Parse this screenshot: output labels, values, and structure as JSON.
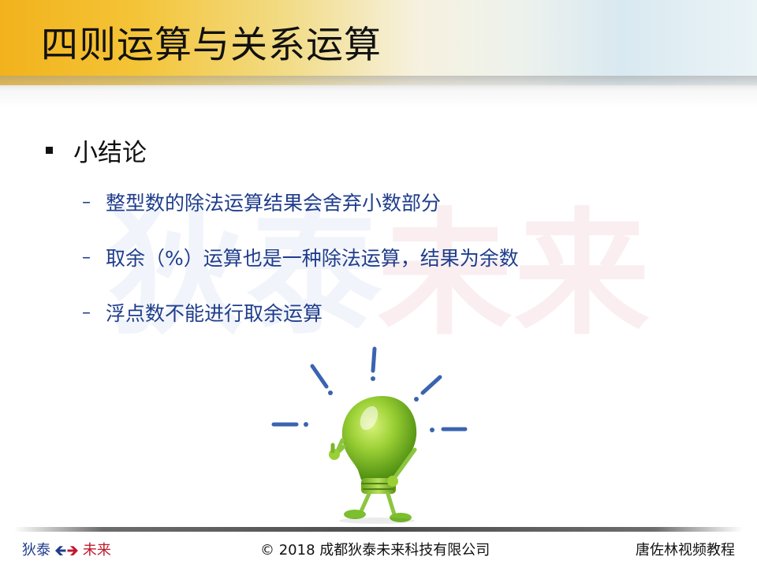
{
  "slide": {
    "title": "四则运算与关系运算",
    "bullet": "小结论",
    "sub_bullets": [
      "整型数的除法运算结果会舍弃小数部分",
      "取余（%）运算也是一种除法运算，结果为余数",
      "浮点数不能进行取余运算"
    ],
    "dash": "–"
  },
  "watermark": {
    "left": "狄泰",
    "right": "未来"
  },
  "footer": {
    "brand_left": "狄泰",
    "brand_right": "未来",
    "arrow_left": "🡸",
    "arrow_right": "🡺",
    "copyright": "© 2018 成都狄泰未来科技有限公司",
    "author": "唐佐林视频教程"
  },
  "colors": {
    "accent_blue": "#1f3d8c",
    "accent_red": "#c0182b",
    "banner_gold": "#f2b21c",
    "bulb_green": "#8cc63f"
  },
  "icons": {
    "bulb": "lightbulb-character-icon",
    "bullet": "square-bullet-icon"
  }
}
